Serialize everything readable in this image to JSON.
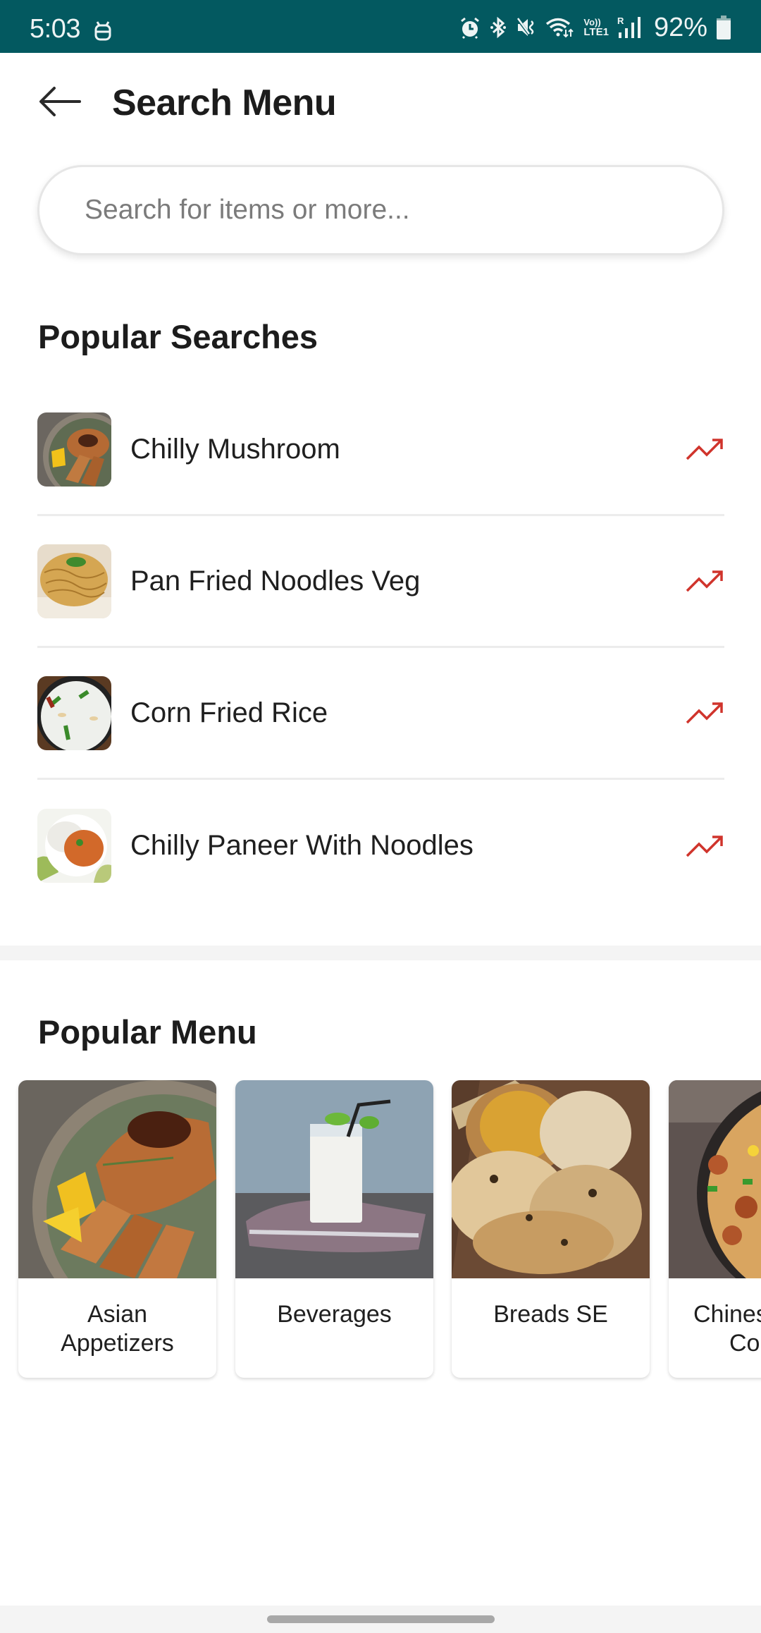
{
  "status_bar": {
    "time": "5:03",
    "left_icons": [
      "notification-app-icon"
    ],
    "right_icons": [
      "alarm-icon",
      "bluetooth-icon",
      "mute-icon",
      "wifi-icon",
      "volte-lte-icon",
      "signal-icon",
      "battery-icon"
    ],
    "volte_line1": "Vo))",
    "volte_line2": "LTE1",
    "roaming": "R",
    "battery_percent": "92%",
    "background_color": "#035960"
  },
  "header": {
    "back_icon": "arrow-left-icon",
    "title": "Search Menu"
  },
  "search": {
    "value": "",
    "placeholder": "Search for items or more..."
  },
  "popular_searches": {
    "title": "Popular Searches",
    "trend_icon": "trending-up-icon",
    "trend_color": "#d0342c",
    "items": [
      {
        "label": "Chilly Mushroom",
        "thumbnail": "grilled-chicken-bowl"
      },
      {
        "label": "Pan Fried Noodles Veg",
        "thumbnail": "noodles-bowl"
      },
      {
        "label": "Corn Fried Rice",
        "thumbnail": "fried-rice-plate"
      },
      {
        "label": "Chilly Paneer With Noodles",
        "thumbnail": "curry-rice-bowl"
      }
    ]
  },
  "popular_menu": {
    "title": "Popular Menu",
    "cards": [
      {
        "label_lines": [
          "Asian",
          "Appetizers"
        ],
        "image": "grilled-chicken-bowl"
      },
      {
        "label_lines": [
          "Beverages"
        ],
        "image": "milk-glass"
      },
      {
        "label_lines": [
          "Breads SE"
        ],
        "image": "indian-breads"
      },
      {
        "label_lines": [
          "Chines",
          "Co"
        ],
        "image": "fried-rice-bowl",
        "clipped": true
      }
    ]
  }
}
